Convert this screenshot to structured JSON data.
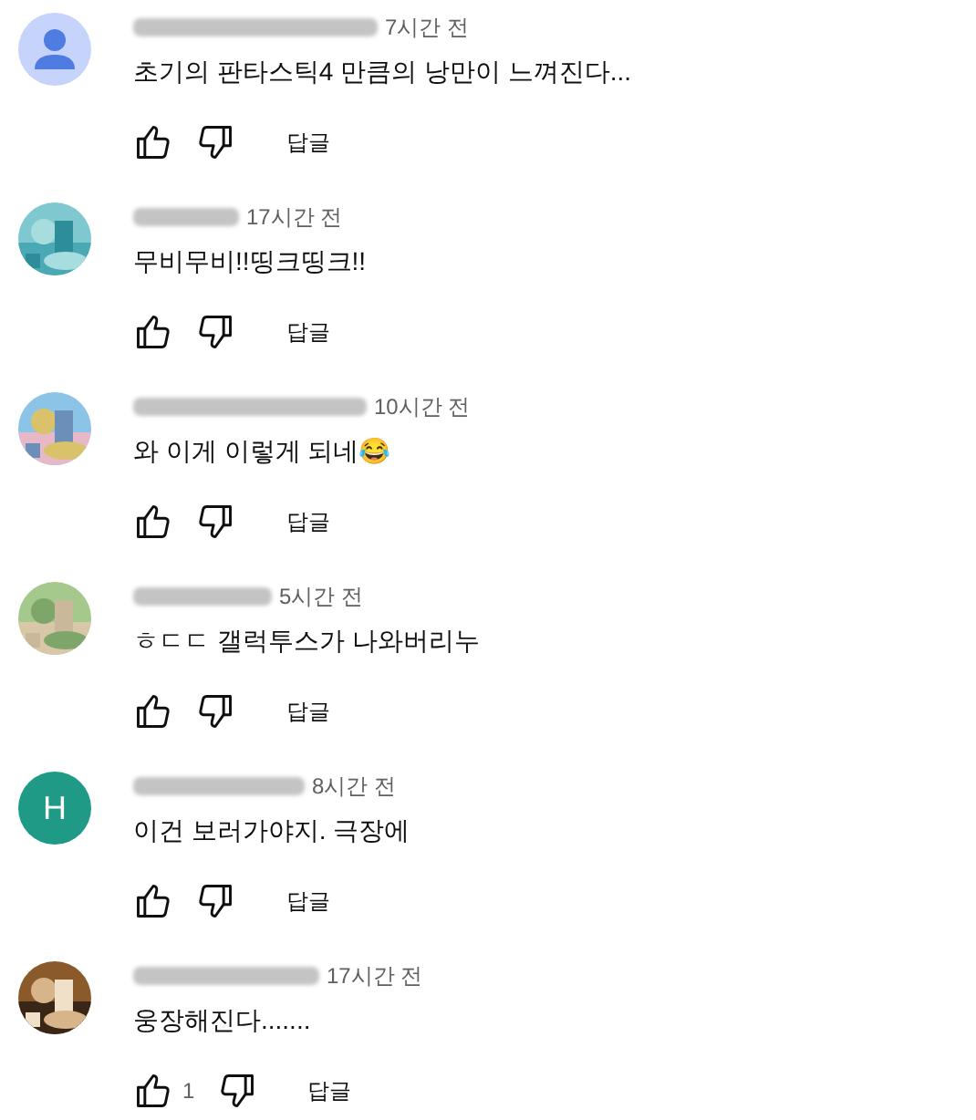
{
  "comments": [
    {
      "avatar": {
        "kind": "default"
      },
      "time": "7시간 전",
      "text": "초기의 판타스틱4 만큼의 낭만이 느껴진다...",
      "reply": "답글"
    },
    {
      "time": "17시간 전",
      "text": "무비무비!!띵크띵크!!",
      "reply": "답글"
    },
    {
      "time": "10시간 전",
      "text": "와 이게 이렇게 되네😂",
      "reply": "답글"
    },
    {
      "time": "5시간 전",
      "text": "ㅎㄷㄷ 갤럭투스가 나와버리누",
      "reply": "답글"
    },
    {
      "avatar": {
        "kind": "letter",
        "letter": "H"
      },
      "time": "8시간 전",
      "text": "이건 보러가야지. 극장에",
      "reply": "답글"
    },
    {
      "time": "17시간 전",
      "text": "웅장해진다.......",
      "likes": "1",
      "reply": "답글"
    }
  ]
}
